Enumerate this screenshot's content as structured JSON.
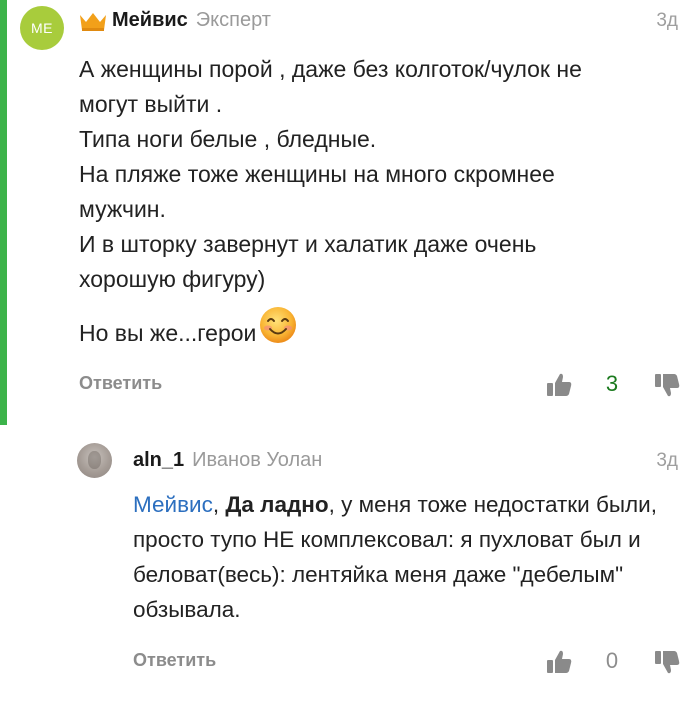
{
  "comments": [
    {
      "avatar_initials": "МЕ",
      "author": "Мейвис",
      "role": "Эксперт",
      "time": "3д",
      "lines": [
        "А женщины порой , даже без колготок/чулок не",
        "могут выйти .",
        "Типа ноги белые , бледные.",
        "На пляже тоже женщины на много скромнее",
        "мужчин.",
        "И в шторку завернут и халатик даже очень",
        "хорошую фигуру)"
      ],
      "last_line": "Но вы же...герои",
      "reply_label": "Ответить",
      "votes": "3"
    },
    {
      "author": "aln_1",
      "role": "Иванов Уолан",
      "time": "3д",
      "mention": "Мейвис",
      "comma": ", ",
      "bold_text": "Да ладно",
      "text": ", у меня тоже недостатки были, просто тупо НЕ комплексовал: я пухловат был и беловат(весь): лентяйка меня даже \"дебелым\" обзывала.",
      "reply_label": "Ответить",
      "votes": "0"
    }
  ],
  "colors": {
    "accent_bar": "#3cb34a",
    "avatar_bg": "#a8cc3c",
    "crown": "#f2a01a",
    "mention": "#2c6fbf",
    "positive_votes": "#1b7a1e",
    "muted": "#8c8c8c"
  },
  "icons": [
    "crown-icon",
    "smiley-emoji",
    "thumbs-up-icon",
    "thumbs-down-icon"
  ]
}
